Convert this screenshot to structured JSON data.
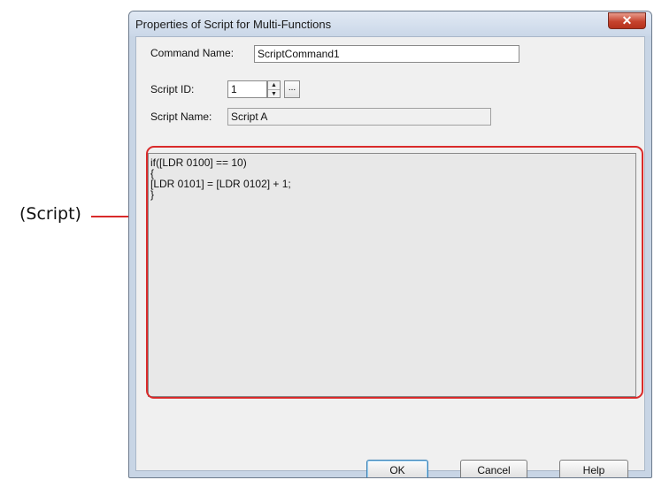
{
  "callout": {
    "label": "(Script)"
  },
  "dialog": {
    "title": "Properties of Script for Multi-Functions",
    "close_label": "✕",
    "command_name": {
      "label": "Command Name:",
      "value": "ScriptCommand1"
    },
    "script_id": {
      "label": "Script ID:",
      "value": "1",
      "browse_label": "..."
    },
    "script_name": {
      "label": "Script Name:",
      "value": "Script A"
    },
    "script_lines": [
      "if([LDR 0100] == 10)",
      "{",
      "[LDR 0101] = [LDR 0102] + 1;",
      "}"
    ],
    "buttons": {
      "ok": "OK",
      "cancel": "Cancel",
      "help": "Help"
    }
  }
}
